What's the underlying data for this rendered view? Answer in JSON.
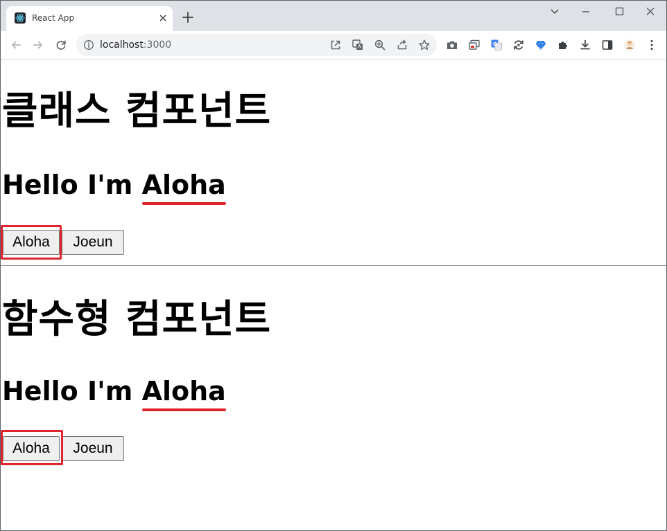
{
  "browser": {
    "tab": {
      "title": "React App",
      "favicon": "react-icon"
    },
    "address_bar": {
      "host": "localhost",
      "port": ":3000"
    },
    "colors": {
      "tabstrip_bg": "#dee1e6",
      "omnibox_bg": "#f1f3f4",
      "highlight": "#e0242e"
    }
  },
  "page": {
    "class_section": {
      "heading": "클래스 컴포넌트",
      "greeting_prefix": "Hello I'm ",
      "greeting_name": "Aloha",
      "buttons": [
        "Aloha",
        "Joeun"
      ]
    },
    "function_section": {
      "heading": "함수형 컴포넌트",
      "greeting_prefix": "Hello I'm ",
      "greeting_name": "Aloha",
      "buttons": [
        "Aloha",
        "Joeun"
      ]
    }
  }
}
